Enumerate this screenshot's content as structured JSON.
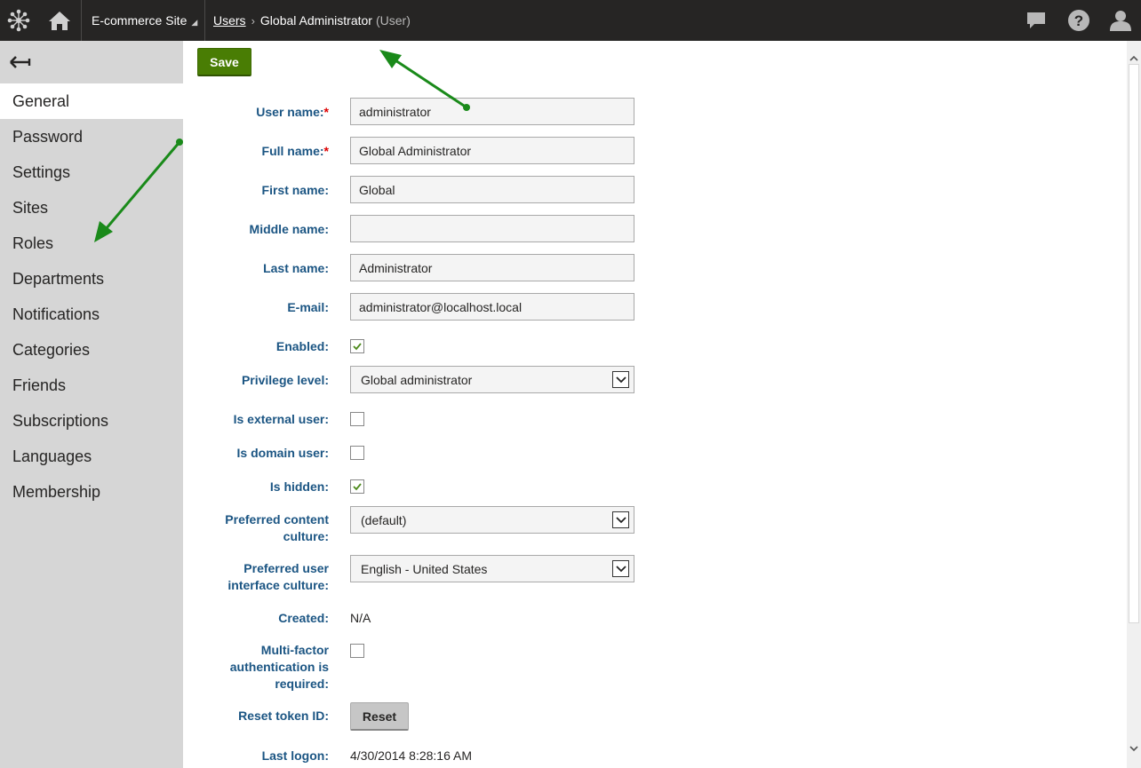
{
  "topbar": {
    "site_name": "E-commerce Site",
    "breadcrumb_link": "Users",
    "breadcrumb_current": "Global Administrator",
    "breadcrumb_type": "(User)"
  },
  "sidebar": {
    "items": [
      {
        "label": "General"
      },
      {
        "label": "Password"
      },
      {
        "label": "Settings"
      },
      {
        "label": "Sites"
      },
      {
        "label": "Roles"
      },
      {
        "label": "Departments"
      },
      {
        "label": "Notifications"
      },
      {
        "label": "Categories"
      },
      {
        "label": "Friends"
      },
      {
        "label": "Subscriptions"
      },
      {
        "label": "Languages"
      },
      {
        "label": "Membership"
      }
    ]
  },
  "toolbar": {
    "save_label": "Save"
  },
  "form": {
    "user_name": {
      "label": "User name:",
      "required": "*",
      "value": "administrator"
    },
    "full_name": {
      "label": "Full name:",
      "required": "*",
      "value": "Global Administrator"
    },
    "first_name": {
      "label": "First name:",
      "value": "Global"
    },
    "middle_name": {
      "label": "Middle name:",
      "value": ""
    },
    "last_name": {
      "label": "Last name:",
      "value": "Administrator"
    },
    "email": {
      "label": "E-mail:",
      "value": "administrator@localhost.local"
    },
    "enabled": {
      "label": "Enabled:",
      "checked": true
    },
    "privilege_level": {
      "label": "Privilege level:",
      "value": "Global administrator"
    },
    "is_external": {
      "label": "Is external user:",
      "checked": false
    },
    "is_domain": {
      "label": "Is domain user:",
      "checked": false
    },
    "is_hidden": {
      "label": "Is hidden:",
      "checked": true
    },
    "pref_content_culture": {
      "label_line1": "Preferred content",
      "label_line2": "culture:",
      "value": "(default)"
    },
    "pref_ui_culture": {
      "label_line1": "Preferred user",
      "label_line2": "interface culture:",
      "value": "English - United States"
    },
    "created": {
      "label": "Created:",
      "value": "N/A"
    },
    "mfa": {
      "label_line1": "Multi-factor",
      "label_line2": "authentication is",
      "label_line3": "required:",
      "checked": false
    },
    "reset_token": {
      "label": "Reset token ID:",
      "button": "Reset"
    },
    "last_logon": {
      "label": "Last logon:",
      "value": "4/30/2014 8:28:16 AM"
    }
  },
  "colors": {
    "topbar_bg": "#262524",
    "sidebar_bg": "#d6d6d6",
    "save_green": "#497d04",
    "label_blue": "#1b5583",
    "annotation_arrow": "#1a8a1a"
  }
}
